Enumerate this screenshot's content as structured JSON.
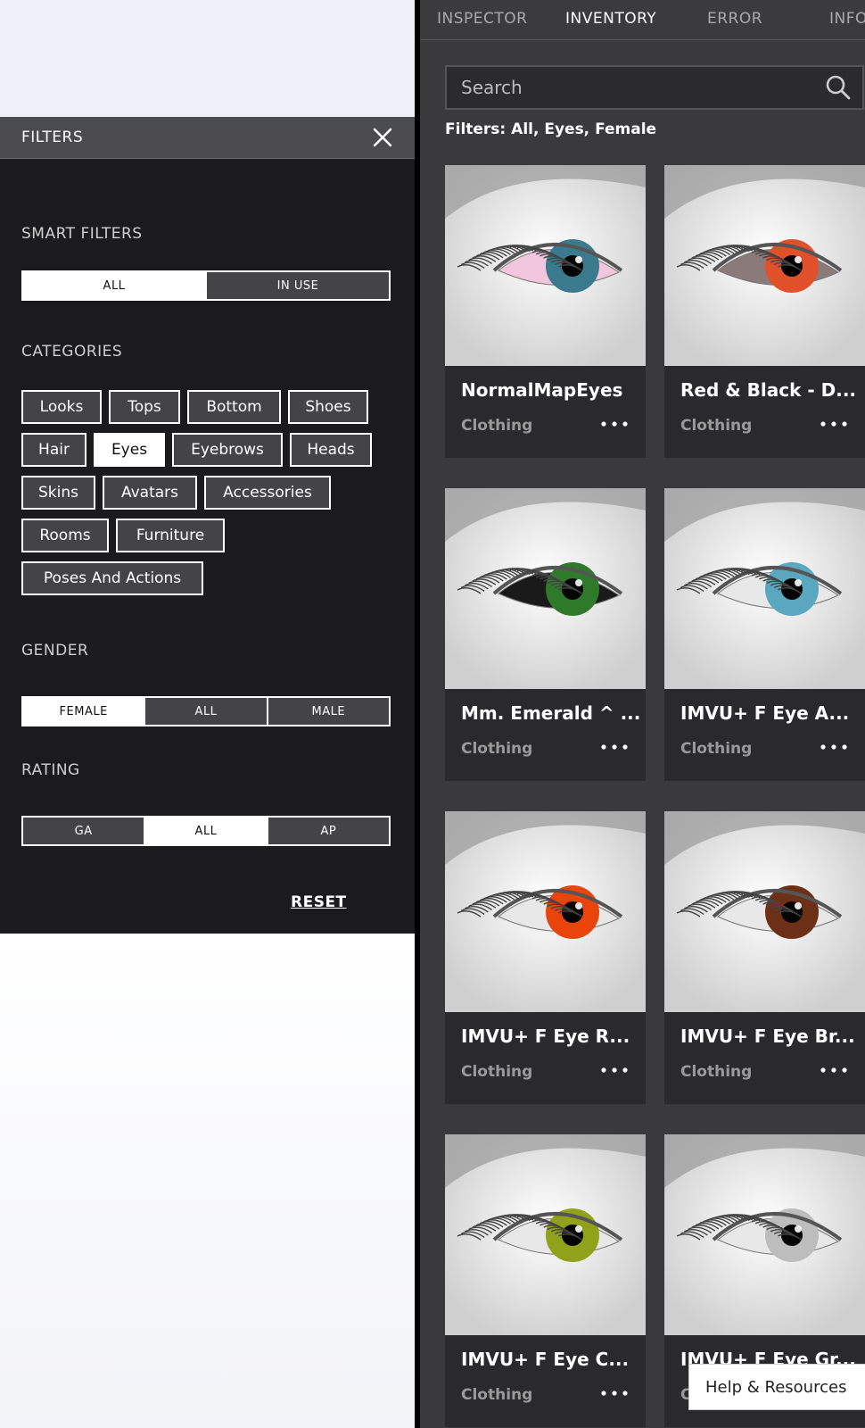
{
  "filters_panel": {
    "title": "FILTERS",
    "smart_filters": {
      "label": "SMART FILTERS",
      "options": [
        "ALL",
        "IN USE"
      ],
      "selected": "ALL"
    },
    "categories": {
      "label": "CATEGORIES",
      "items": [
        "Looks",
        "Tops",
        "Bottom",
        "Shoes",
        "Hair",
        "Eyes",
        "Eyebrows",
        "Heads",
        "Skins",
        "Avatars",
        "Accessories",
        "Rooms",
        "Furniture",
        "Poses And Actions"
      ],
      "selected": "Eyes"
    },
    "gender": {
      "label": "GENDER",
      "options": [
        "FEMALE",
        "ALL",
        "MALE"
      ],
      "selected": "FEMALE"
    },
    "rating": {
      "label": "RATING",
      "options": [
        "GA",
        "ALL",
        "AP"
      ],
      "selected": "ALL"
    },
    "reset_label": "RESET"
  },
  "tabs": [
    {
      "label": "INSPECTOR",
      "active": false
    },
    {
      "label": "INVENTORY",
      "active": true
    },
    {
      "label": "ERROR",
      "active": false
    },
    {
      "label": "INFO",
      "active": false
    }
  ],
  "search": {
    "placeholder": "Search"
  },
  "active_filters": {
    "label": "Filters:",
    "value": "All, Eyes, Female"
  },
  "items": [
    {
      "name": "NormalMapEyes",
      "type": "Clothing",
      "iris_color": "#3a7a8c",
      "sclera_color": "#f2c6dc"
    },
    {
      "name": "Red & Black - D...",
      "type": "Clothing",
      "iris_color": "#e0502a",
      "sclera_color": "#8a7a7a"
    },
    {
      "name": "Mm. Emerald ^ ...",
      "type": "Clothing",
      "iris_color": "#2f7a2a",
      "sclera_color": "#1a1a1a"
    },
    {
      "name": "IMVU+ F Eye A...",
      "type": "Clothing",
      "iris_color": "#5aa8c0",
      "sclera_color": "#e8e8e8"
    },
    {
      "name": "IMVU+ F Eye R...",
      "type": "Clothing",
      "iris_color": "#e8440c",
      "sclera_color": "#e8e8e8"
    },
    {
      "name": "IMVU+ F Eye Br...",
      "type": "Clothing",
      "iris_color": "#6b3015",
      "sclera_color": "#e8e8e8"
    },
    {
      "name": "IMVU+ F Eye C...",
      "type": "Clothing",
      "iris_color": "#8fa21a",
      "sclera_color": "#e8e8e8"
    },
    {
      "name": "IMVU+ F Eye Gr...",
      "type": "Clothing",
      "iris_color": "#bdbdbd",
      "sclera_color": "#e8e8e8"
    }
  ],
  "help_button": {
    "label": "Help & Resources"
  }
}
